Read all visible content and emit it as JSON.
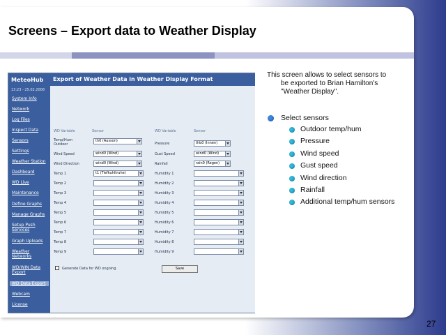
{
  "slide": {
    "title": "Screens – Export data to Weather Display",
    "page_number": "27",
    "description_line1": "This screen allows to select sensors to",
    "description_line2": "be exported to Brian Hamilton's",
    "description_line3": "\"Weather Display\".",
    "bullet": "Select sensors",
    "sub_bullets": [
      "Outdoor temp/hum",
      "Pressure",
      "Wind speed",
      "Gust speed",
      "Wind direction",
      "Rainfall",
      "Additional temp/hum sensors"
    ]
  },
  "screenshot": {
    "brand": "MeteoHub",
    "datestamp": "13:23 - 25.02.2008",
    "header_title": "Export of Weather Data in Weather Display Format",
    "nav": [
      "System Info",
      "Network",
      "Log Files",
      "Inspect Data",
      "Sensors",
      "Settings",
      "Weather Station",
      "Dashboard",
      "WD Live",
      "Maintenance",
      "Define Graphs",
      "Manage Graphs",
      "Setup Push Services",
      "Graph Uploads",
      "Weather Networks",
      "WD/WIN Data Export",
      "WD Data Export",
      "Webcam",
      "License"
    ],
    "columns": {
      "wd_variable": "WD Variable",
      "sensor": "Sensor"
    },
    "left_rows": [
      {
        "label": "Temp/Hum Outdoor",
        "value": "th0 (Ausson)"
      },
      {
        "label": "Wind Speed",
        "value": "wind0 (Wind)"
      },
      {
        "label": "Wind Direction",
        "value": "wind0 (Wind)"
      },
      {
        "label": "Temp 1",
        "value": "t1 (Tiefkuhltruhe)"
      },
      {
        "label": "Temp 2",
        "value": ""
      },
      {
        "label": "Temp 3",
        "value": ""
      },
      {
        "label": "Temp 4",
        "value": ""
      },
      {
        "label": "Temp 5",
        "value": ""
      },
      {
        "label": "Temp 6",
        "value": ""
      },
      {
        "label": "Temp 7",
        "value": ""
      },
      {
        "label": "Temp 8",
        "value": ""
      },
      {
        "label": "Temp 9",
        "value": ""
      }
    ],
    "right_rows": [
      {
        "label": "Pressure",
        "value": "thb0 (Innen)"
      },
      {
        "label": "Gust Speed",
        "value": "wind0 (Wind)"
      },
      {
        "label": "Rainfall",
        "value": "rain0 (Regen)"
      },
      {
        "label": "Humidity 1",
        "value": ""
      },
      {
        "label": "Humidity 2",
        "value": ""
      },
      {
        "label": "Humidity 3",
        "value": ""
      },
      {
        "label": "Humidity 4",
        "value": ""
      },
      {
        "label": "Humidity 5",
        "value": ""
      },
      {
        "label": "Humidity 6",
        "value": ""
      },
      {
        "label": "Humidity 7",
        "value": ""
      },
      {
        "label": "Humidity 8",
        "value": ""
      },
      {
        "label": "Humidity 9",
        "value": ""
      }
    ],
    "generate_label": "Generate Data for WD ongoing",
    "apply_button": "Save"
  },
  "colors": {
    "accent": "#3b5f9e",
    "bullet": "#3a88e0",
    "sub_bullet": "#31b8d9"
  }
}
